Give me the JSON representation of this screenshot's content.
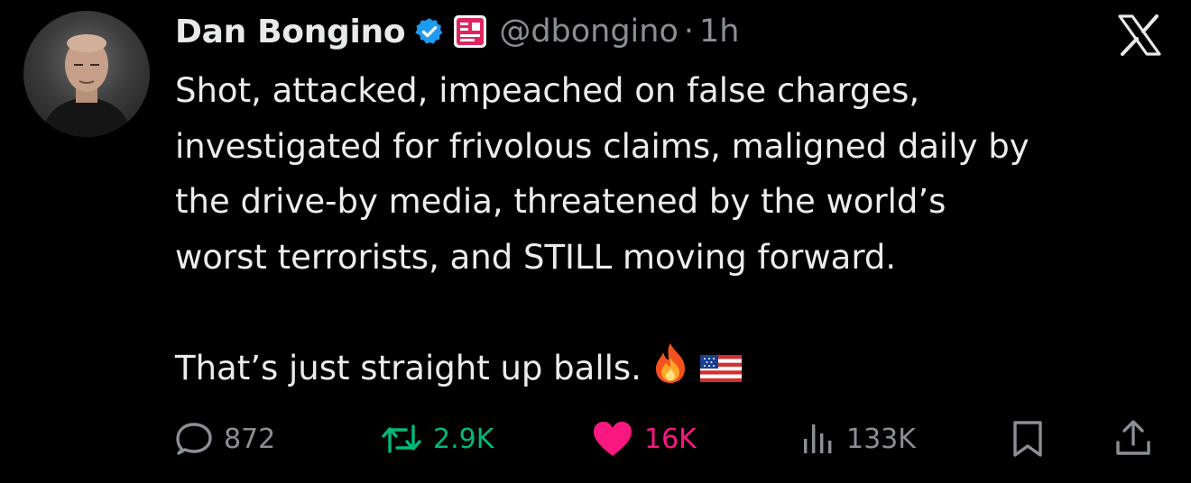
{
  "author": {
    "name": "Dan Bongino",
    "handle": "@dbongino",
    "separator": "·",
    "time": "1h"
  },
  "tweet": {
    "lines": [
      "Shot, attacked, impeached on false charges,",
      "investigated for frivolous claims, maligned daily by",
      "the drive-by media, threatened by the world’s",
      "worst terrorists, and STILL moving forward."
    ],
    "closing_line": "That’s just straight up balls.",
    "emojis": [
      "fire-emoji",
      "us-flag-emoji"
    ]
  },
  "actions": {
    "replies": "872",
    "reposts": "2.9K",
    "likes": "16K",
    "views": "133K"
  },
  "colors": {
    "background": "#000000",
    "text": "#e7e9ea",
    "muted": "#8b8f94",
    "verified": "#1d9bf0",
    "repost": "#00ba7c",
    "like": "#f91880",
    "affiliate_badge": "#e0245e"
  },
  "icons": [
    "verified-badge-icon",
    "affiliate-badge-icon",
    "x-logo-icon",
    "reply-icon",
    "repost-icon",
    "like-icon",
    "views-icon",
    "bookmark-icon",
    "share-icon"
  ]
}
